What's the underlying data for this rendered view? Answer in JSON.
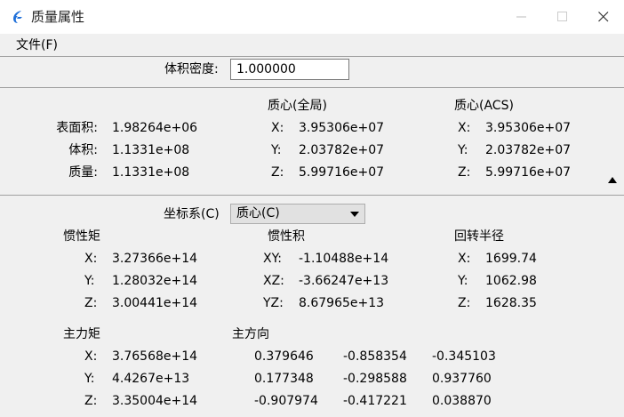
{
  "window": {
    "title": "质量属性"
  },
  "menu": {
    "file": "文件(F)"
  },
  "density": {
    "label": "体积密度:",
    "value": "1.000000"
  },
  "global": {
    "header_center": "质心(全局)",
    "header_acs": "质心(ACS)",
    "area_label": "表面积:",
    "area_value": "1.98264e+06",
    "volume_label": "体积:",
    "volume_value": "1.1331e+08",
    "mass_label": "质量:",
    "mass_value": "1.1331e+08",
    "center": [
      {
        "axis": "X:",
        "value": "3.95306e+07"
      },
      {
        "axis": "Y:",
        "value": "2.03782e+07"
      },
      {
        "axis": "Z:",
        "value": "5.99716e+07"
      }
    ],
    "acs": [
      {
        "axis": "X:",
        "value": "3.95306e+07"
      },
      {
        "axis": "Y:",
        "value": "2.03782e+07"
      },
      {
        "axis": "Z:",
        "value": "5.99716e+07"
      }
    ]
  },
  "coords": {
    "label": "坐标系(C)",
    "selected": "质心(C)"
  },
  "inertia": {
    "moment_header": "惯性矩",
    "product_header": "惯性积",
    "gyration_header": "回转半径",
    "moment": [
      {
        "axis": "X:",
        "value": "3.27366e+14"
      },
      {
        "axis": "Y:",
        "value": "1.28032e+14"
      },
      {
        "axis": "Z:",
        "value": "3.00441e+14"
      }
    ],
    "product": [
      {
        "axis": "XY:",
        "value": "-1.10488e+14"
      },
      {
        "axis": "XZ:",
        "value": "-3.66247e+13"
      },
      {
        "axis": "YZ:",
        "value": "8.67965e+13"
      }
    ],
    "gyration": [
      {
        "axis": "X:",
        "value": "1699.74"
      },
      {
        "axis": "Y:",
        "value": "1062.98"
      },
      {
        "axis": "Z:",
        "value": "1628.35"
      }
    ]
  },
  "principal": {
    "moment_header": "主力矩",
    "direction_header": "主方向",
    "moments": [
      {
        "axis": "X:",
        "value": "3.76568e+14"
      },
      {
        "axis": "Y:",
        "value": "4.4267e+13"
      },
      {
        "axis": "Z:",
        "value": "3.35004e+14"
      }
    ],
    "directions": [
      [
        "0.379646",
        "-0.858354",
        "-0.345103"
      ],
      [
        "0.177348",
        "-0.298588",
        "0.937760"
      ],
      [
        "-0.907974",
        "-0.417221",
        "0.038870"
      ]
    ]
  }
}
